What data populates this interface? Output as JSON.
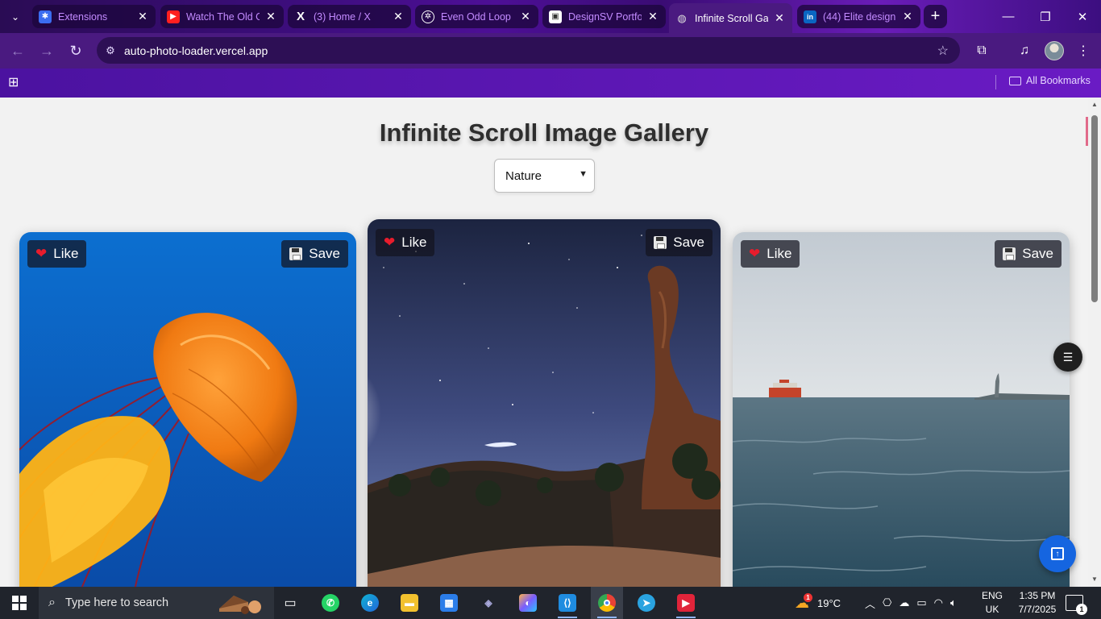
{
  "browser": {
    "tabs": [
      {
        "title": "Extensions",
        "icon": "puzzle-icon"
      },
      {
        "title": "Watch The Old G",
        "icon": "youtube-icon"
      },
      {
        "title": "(3) Home / X",
        "icon": "x-logo-icon"
      },
      {
        "title": "Even Odd Loop",
        "icon": "openai-icon"
      },
      {
        "title": "DesignSV Portfo",
        "icon": "site-favicon"
      },
      {
        "title": "Infinite Scroll Ga",
        "icon": "globe-icon",
        "active": true
      },
      {
        "title": "(44) Elite design",
        "icon": "linkedin-icon"
      }
    ],
    "close_glyph": "✕",
    "new_tab_glyph": "+",
    "url": "auto-photo-loader.vercel.app",
    "bookmarks_label": "All Bookmarks",
    "theme_color": "#4a1a80"
  },
  "page": {
    "title": "Infinite Scroll Image Gallery",
    "category": {
      "selected": "Nature"
    },
    "cards": [
      {
        "like_label": "Like",
        "save_label": "Save",
        "subject": "orange jellyfish on blue water"
      },
      {
        "like_label": "Like",
        "save_label": "Save",
        "subject": "starry night sky over rock formation"
      },
      {
        "like_label": "Like",
        "save_label": "Save",
        "subject": "ferry on sea with statue of liberty"
      }
    ],
    "accent_color": "#1565e0"
  },
  "taskbar": {
    "search_placeholder": "Type here to search",
    "weather": "19°C",
    "weather_badge": "1",
    "language": {
      "line1": "ENG",
      "line2": "UK"
    },
    "time": "1:35 PM",
    "date": "7/7/2025",
    "notifications": "1",
    "apps": [
      "task-view-icon",
      "whatsapp-icon",
      "edge-icon",
      "file-explorer-icon",
      "store-icon",
      "app-icon",
      "copilot-icon",
      "vscode-icon",
      "chrome-icon",
      "telegram-icon",
      "media-app-icon"
    ]
  }
}
